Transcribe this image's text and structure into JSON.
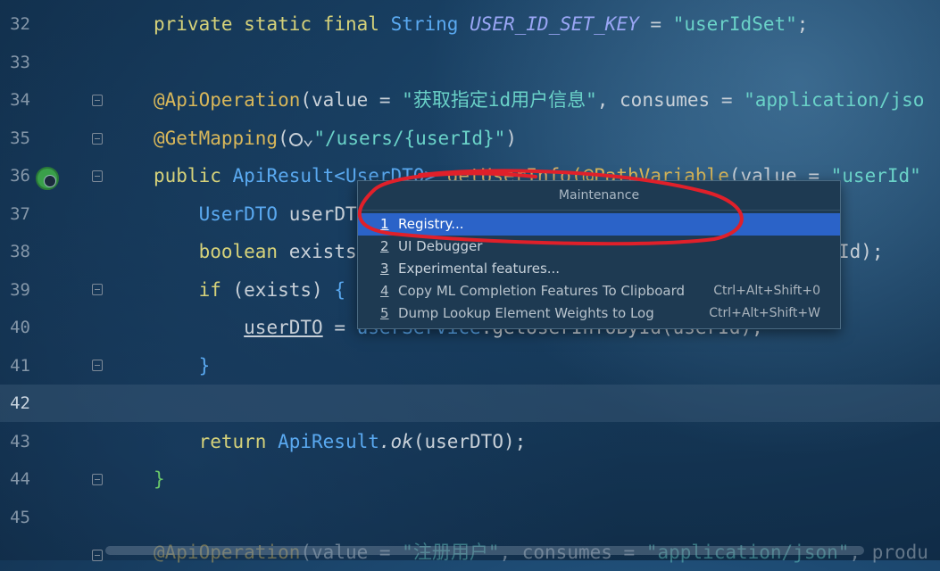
{
  "editor": {
    "lines": [
      {
        "num": "32"
      },
      {
        "num": "33"
      },
      {
        "num": "34"
      },
      {
        "num": "35"
      },
      {
        "num": "36"
      },
      {
        "num": "37"
      },
      {
        "num": "38"
      },
      {
        "num": "39"
      },
      {
        "num": "40"
      },
      {
        "num": "41"
      },
      {
        "num": "42"
      },
      {
        "num": "43"
      },
      {
        "num": "44"
      },
      {
        "num": "45"
      }
    ],
    "code": {
      "l32_private": "private",
      "l32_static": "static",
      "l32_final": "final",
      "l32_string": "String",
      "l32_const": "USER_ID_SET_KEY",
      "l32_eq": "=",
      "l32_val": "\"userIdSet\"",
      "l32_semi": ";",
      "l34_ann": "@ApiOperation",
      "l34_rest1": "(value = ",
      "l34_str1": "\"获取指定id用户信息\"",
      "l34_rest2": ", consumes = ",
      "l34_str2": "\"application/jso",
      "l35_ann": "@GetMapping",
      "l35_paren": "(",
      "l35_chev": "⌄",
      "l35_str": "\"/users/{userId}\"",
      "l35_close": ")",
      "l36_public": "public",
      "l36_type": "ApiResult<UserDTO>",
      "l36_fn": "getUserInfo",
      "l36_ann": "(@PathVariable",
      "l36_rest": "(value = ",
      "l36_str": "\"userId\"",
      "l37_type": "UserDTO",
      "l37_var": "userDT",
      "l38_kw": "boolean",
      "l38_var": "exists",
      "l38_tail": "Id);",
      "l39_if": "if",
      "l39_rest": " (exists) ",
      "l39_brace": "{",
      "l40_var": "userDTO",
      "l40_eq": " = ",
      "l40_svc": "userService",
      "l40_call": ".getUserInfoById(userId);",
      "l41_brace": "}",
      "l43_return": "return",
      "l43_type": "ApiResult",
      "l43_ok": ".ok",
      "l43_rest": "(userDTO);",
      "l44_brace": "}",
      "l45_ann": "@ApiOperation",
      "l45_rest": "(value = ",
      "l45_str": "\"注册用户\"",
      "l45_rest2": ", consumes = ",
      "l45_str2": "\"application/json\"",
      "l45_tail": ", produ"
    }
  },
  "popup": {
    "title": "Maintenance",
    "items": [
      {
        "num": "1",
        "label": "Registry...",
        "shortcut": ""
      },
      {
        "num": "2",
        "label": "UI Debugger",
        "shortcut": ""
      },
      {
        "num": "3",
        "label": "Experimental features...",
        "shortcut": ""
      },
      {
        "num": "4",
        "label": "Copy ML Completion Features To Clipboard",
        "shortcut": "Ctrl+Alt+Shift+0"
      },
      {
        "num": "5",
        "label": "Dump Lookup Element Weights to Log",
        "shortcut": "Ctrl+Alt+Shift+W"
      }
    ],
    "selected_index": 0
  },
  "colors": {
    "selection": "#2b63c8",
    "annotation_stroke": "#e0202a",
    "popup_bg": "#1e3a52"
  },
  "icons": {
    "gutter": "web-globe-icon",
    "inline": "globe-icon",
    "fold": "fold-marker-icon"
  }
}
